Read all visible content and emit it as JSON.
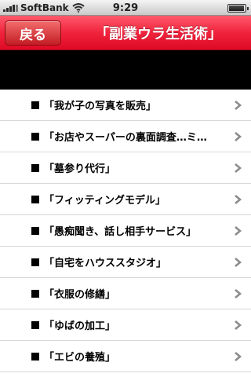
{
  "status_bar": {
    "carrier": "SoftBank",
    "time": "9:29",
    "signal_icon": "signal-bars-icon",
    "wifi_icon": "wifi-icon",
    "battery_icon": "battery-icon",
    "battery_level": 0.95
  },
  "nav": {
    "back_label": "戻る",
    "title": "「副業ウラ生活術」"
  },
  "colors": {
    "nav_red": "#f0233d",
    "back_button": "#c31d24",
    "banner": "#000000",
    "separator": "#d7d7d7",
    "chevron": "#8c8c8c"
  },
  "list": {
    "items": [
      {
        "label": "「我が子の写真を販売」"
      },
      {
        "label": "「お店やスーパーの裏面調査…ミ…"
      },
      {
        "label": "「墓参り代行」"
      },
      {
        "label": "「フィッティングモデル」"
      },
      {
        "label": "「愚痴聞き、話し相手サービス」"
      },
      {
        "label": "「自宅をハウススタジオ」"
      },
      {
        "label": "「衣服の修繕」"
      },
      {
        "label": "「ゆばの加工」"
      },
      {
        "label": "「エビの養殖」"
      }
    ],
    "bullet_icon": "black-square-icon",
    "chevron_icon": "chevron-right-icon"
  }
}
